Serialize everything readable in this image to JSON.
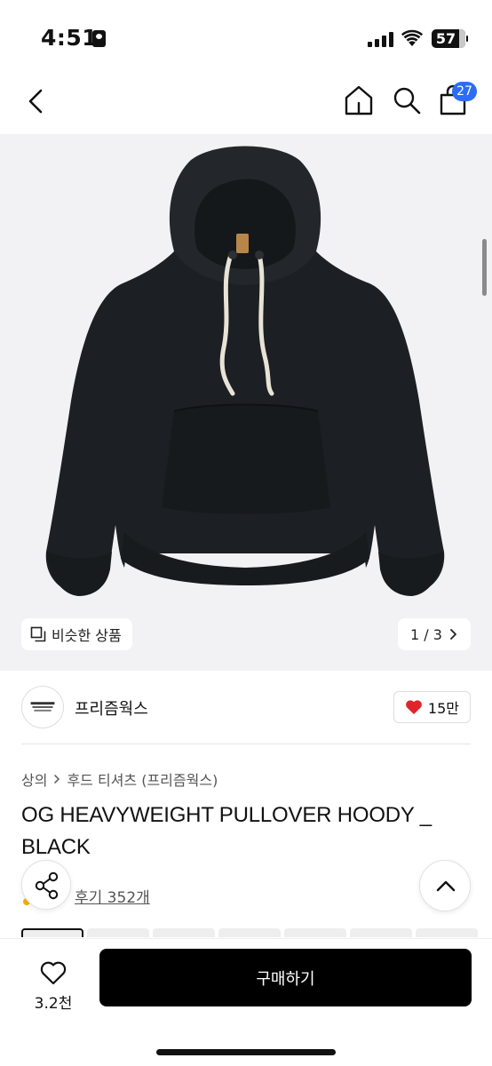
{
  "status_bar": {
    "time": "4:51",
    "battery": "57"
  },
  "nav": {
    "cart_count": "27"
  },
  "gallery": {
    "similar_label": "비슷한 상품",
    "page_counter": "1 / 3"
  },
  "brand": {
    "name": "프리즘웍스",
    "likes": "15만"
  },
  "breadcrumb": {
    "category": "상의",
    "subcategory": "후드 티셔츠 (프리즘웍스)"
  },
  "product": {
    "title": "OG HEAVYWEIGHT PULLOVER HOODY _ BLACK",
    "reviews": "후기 352개"
  },
  "bottom_bar": {
    "wish_count": "3.2천",
    "buy_label": "구매하기"
  },
  "colors": {
    "accent_badge": "#2d6cf5",
    "like_heart": "#e0242c",
    "buy_button": "#000000"
  },
  "icons": [
    "back-icon",
    "home-icon",
    "search-icon",
    "shopping-bag-icon",
    "copy-icon",
    "chevron-right-icon",
    "heart-icon",
    "share-icon",
    "chevron-up-icon"
  ]
}
